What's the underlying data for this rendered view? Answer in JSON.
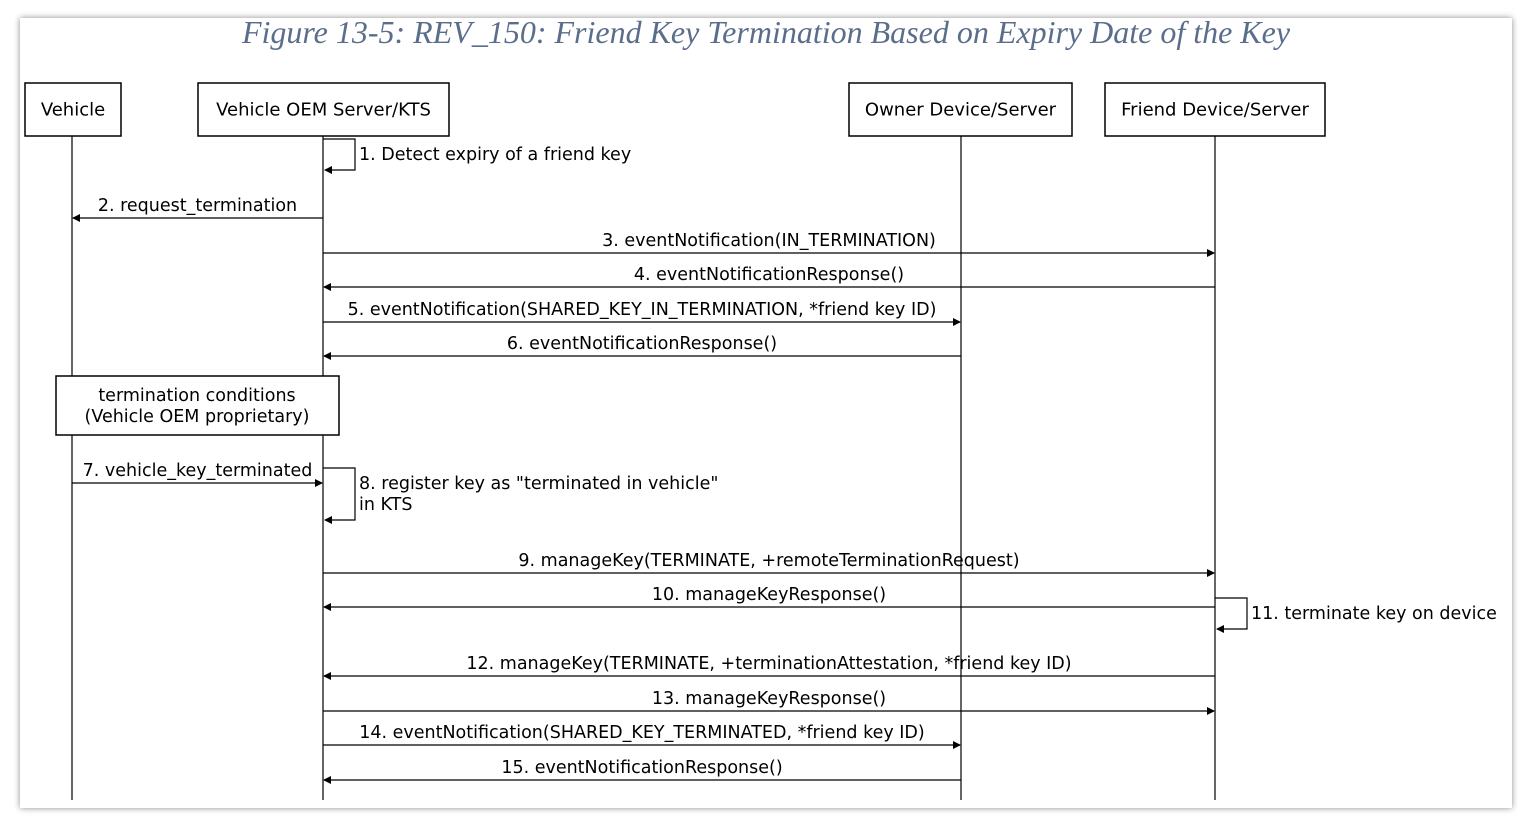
{
  "title": "Figure 13-5: REV_150: Friend Key Termination Based on Expiry Date of the Key",
  "participants": [
    {
      "id": "vehicle",
      "label": "Vehicle"
    },
    {
      "id": "oem",
      "label": "Vehicle OEM Server/KTS"
    },
    {
      "id": "owner",
      "label": "Owner Device/Server"
    },
    {
      "id": "friend",
      "label": "Friend Device/Server"
    }
  ],
  "messages": [
    {
      "from": "oem",
      "to": "oem",
      "label": [
        "1. Detect expiry of a friend key"
      ]
    },
    {
      "from": "oem",
      "to": "vehicle",
      "label": [
        "2. request_termination"
      ]
    },
    {
      "from": "oem",
      "to": "friend",
      "label": [
        "3. eventNotification(IN_TERMINATION)"
      ]
    },
    {
      "from": "friend",
      "to": "oem",
      "label": [
        "4. eventNotificationResponse()"
      ]
    },
    {
      "from": "oem",
      "to": "owner",
      "label": [
        "5. eventNotification(SHARED_KEY_IN_TERMINATION, *friend key ID)"
      ]
    },
    {
      "from": "owner",
      "to": "oem",
      "label": [
        "6. eventNotificationResponse()"
      ]
    },
    {
      "note": [
        "termination conditions",
        "(Vehicle OEM proprietary)"
      ]
    },
    {
      "from": "vehicle",
      "to": "oem",
      "label": [
        "7. vehicle_key_terminated"
      ]
    },
    {
      "from": "oem",
      "to": "oem",
      "label": [
        "8. register key as \"terminated in vehicle\"",
        "in KTS"
      ]
    },
    {
      "from": "oem",
      "to": "friend",
      "label": [
        "9. manageKey(TERMINATE, +remoteTerminationRequest)"
      ]
    },
    {
      "from": "friend",
      "to": "oem",
      "label": [
        "10. manageKeyResponse()"
      ]
    },
    {
      "from": "friend",
      "to": "friend",
      "label": [
        "11. terminate key on device"
      ]
    },
    {
      "from": "friend",
      "to": "oem",
      "label": [
        "12. manageKey(TERMINATE, +terminationAttestation, *friend key ID)"
      ]
    },
    {
      "from": "oem",
      "to": "friend",
      "label": [
        "13. manageKeyResponse()"
      ]
    },
    {
      "from": "oem",
      "to": "owner",
      "label": [
        "14. eventNotification(SHARED_KEY_TERMINATED, *friend key ID)"
      ]
    },
    {
      "from": "owner",
      "to": "oem",
      "label": [
        "15. eventNotificationResponse()"
      ]
    }
  ]
}
